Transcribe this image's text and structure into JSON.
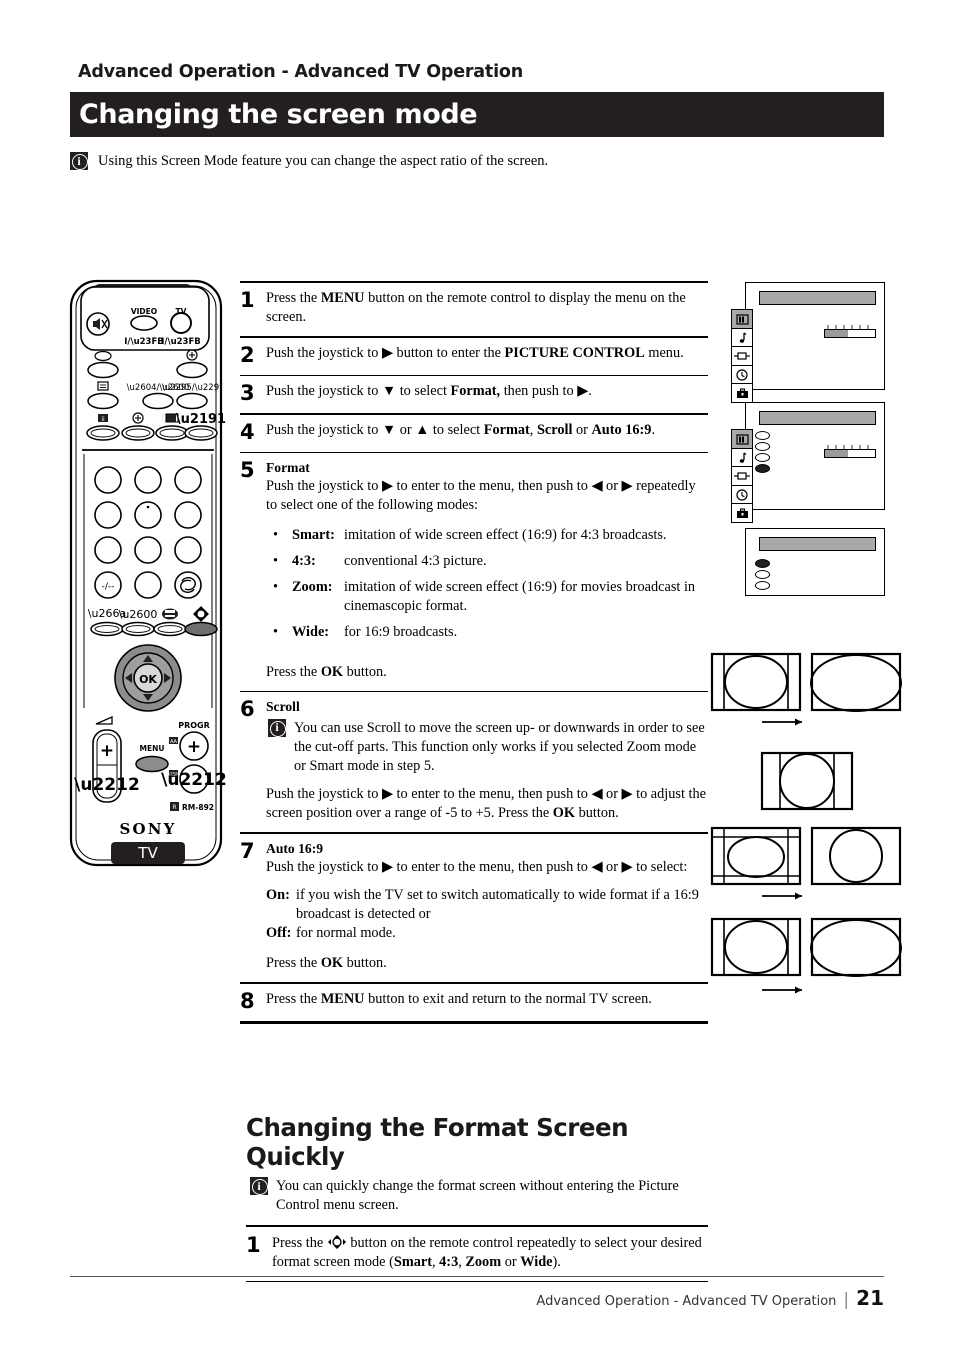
{
  "header": {
    "kicker": "Advanced Operation - Advanced TV Operation",
    "title": "Changing the screen mode"
  },
  "lead_note": "Using this Screen Mode feature you can change the aspect ratio of the screen.",
  "info_icon_glyph": "i",
  "steps": [
    {
      "num": "1",
      "text_parts": [
        "Press the ",
        "MENU",
        " button on the remote control to display the menu on the screen."
      ]
    },
    {
      "num": "2",
      "text_parts": [
        "Push the joystick to ",
        "▶",
        " button to enter the ",
        "PICTURE CONTROL",
        " menu."
      ]
    },
    {
      "num": "3",
      "text_parts": [
        "Push the joystick to ",
        "▼",
        " to select ",
        "Format,",
        " then push to ",
        "▶",
        "."
      ]
    },
    {
      "num": "4",
      "text_parts": [
        "Push the joystick to ",
        "▼",
        " or ",
        "▲",
        " to select ",
        "Format",
        ", ",
        "Scroll",
        " or ",
        "Auto 16:9",
        "."
      ]
    }
  ],
  "step5": {
    "num": "5",
    "subhead": "Format",
    "intro": "Push the joystick to ▶ to enter to the menu, then push to ◀ or ▶ repeatedly to select one of the following modes:",
    "modes": [
      {
        "term": "Smart:",
        "def": "imitation of wide screen effect (16:9) for 4:3 broadcasts."
      },
      {
        "term": "4:3:",
        "def": "conventional 4:3 picture."
      },
      {
        "term": "Zoom:",
        "def": "imitation of wide screen effect (16:9) for movies broadcast in cinemascopic format."
      },
      {
        "term": "Wide:",
        "def": "for 16:9 broadcasts."
      }
    ],
    "outro_pre": "Press the ",
    "outro_bold": "OK",
    "outro_post": " button."
  },
  "step6": {
    "num": "6",
    "subhead": "Scroll",
    "note": "You can use Scroll to move the screen up- or downwards in order to see the cut-off parts. This function only works if you selected Zoom mode or Smart mode in step 5.",
    "body_pre": "Push the joystick to ▶ to enter to the menu, then push to ◀ or ▶  to adjust the screen position over a range of -5 to +5. Press the ",
    "body_bold": "OK",
    "body_post": " button."
  },
  "step7": {
    "num": "7",
    "subhead": "Auto 16:9",
    "intro": "Push the joystick to ▶ to enter to the menu, then push to ◀ or ▶ to select:",
    "options": [
      {
        "term": "On:",
        "def": "if you wish the TV set to switch automatically to wide format if a 16:9 broadcast is detected or"
      },
      {
        "term": "Off:",
        "def": "for normal mode."
      }
    ],
    "outro_pre": "Press the ",
    "outro_bold": "OK",
    "outro_post": " button."
  },
  "step8": {
    "num": "8",
    "pre": "Press the ",
    "bold": "MENU",
    "post": " button to exit and return to the normal TV screen."
  },
  "section2": {
    "heading": "Changing the Format Screen Quickly",
    "note": "You can quickly change the format screen without entering the Picture Control menu screen.",
    "step": {
      "num": "1",
      "pre": "Press the ",
      "icon": "format-button-icon",
      "mid": " button on the remote control repeatedly to select your desired format screen mode (",
      "modes": [
        "Smart",
        "4:3",
        "Zoom",
        "Wide"
      ],
      "sep1": ", ",
      "sep_or": " or ",
      "post": ")."
    }
  },
  "footer": {
    "text": "Advanced Operation - Advanced TV Operation",
    "separator": "|",
    "page": "21"
  },
  "remote": {
    "brand": "SONY",
    "device_label": "TV",
    "model": "RM-892",
    "model_prefix_icon": "remote-commander-icon",
    "video_label": "VIDEO",
    "tv_label": "TV",
    "standby_video": "I/⏻",
    "standby_tv": "I/⏻",
    "mute_icon": "mute-icon",
    "menu_label": "MENU",
    "ok_label": "OK",
    "progr_label": "PROGR",
    "volume_icon": "volume-icon",
    "plus": "+",
    "minus": "−",
    "keypad": [
      "",
      "",
      "",
      "",
      "",
      "",
      "",
      "",
      "",
      "-/--",
      "",
      "recall-icon"
    ],
    "function_row": [
      "audio-icon",
      "picture-icon",
      "teletext-icon",
      "format-icon"
    ],
    "function_selected_index": 3
  },
  "osd_menus": [
    {
      "name": "picture-control-menu",
      "sidebar_icons": [
        "picture-icon",
        "audio-icon",
        "video-icon",
        "timer-icon",
        "setup-icon"
      ],
      "selected_sidebar_index": 0,
      "slider_fill_percent": 45
    },
    {
      "name": "format-submenu",
      "sidebar_icons": [
        "picture-icon",
        "audio-icon",
        "video-icon",
        "timer-icon",
        "setup-icon"
      ],
      "selected_sidebar_index": 0,
      "options_count": 4,
      "selected_option_index": 3,
      "slider_fill_percent": 45
    },
    {
      "name": "auto-169-submenu",
      "options_count": 3,
      "selected_option_index": 0
    }
  ],
  "figures": [
    {
      "name": "format-smart-wide-figure",
      "arrow": "→"
    },
    {
      "name": "format-zoom-figure"
    },
    {
      "name": "scroll-figure",
      "arrow": "→"
    },
    {
      "name": "auto-169-figure",
      "arrow": "→"
    }
  ],
  "colors": {
    "title_bar": "#231f1f",
    "osd_band": "#a9a9a9",
    "selected_button": "#6f6f6f"
  }
}
